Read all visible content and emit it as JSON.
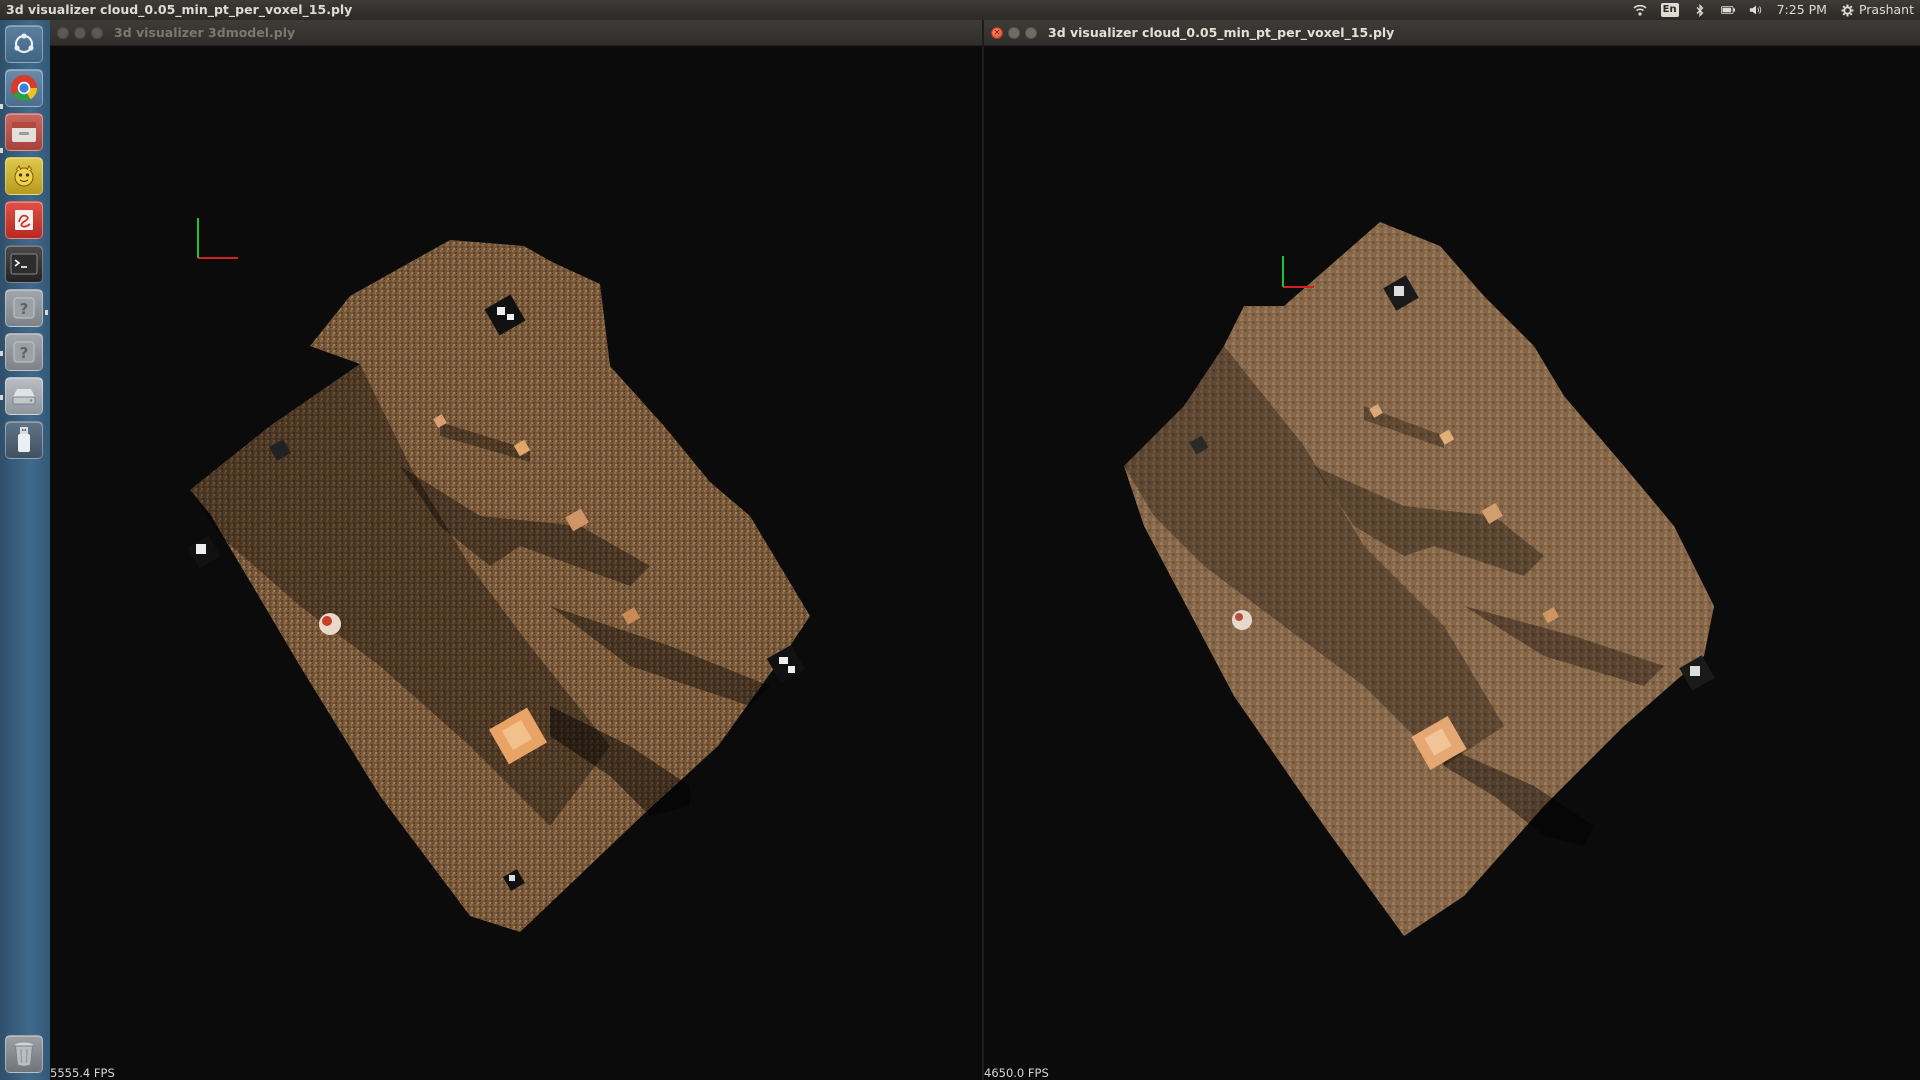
{
  "top_panel": {
    "title": "3d visualizer cloud_0.05_min_pt_per_voxel_15.ply",
    "indicators": {
      "wifi_icon": "wifi-icon",
      "keyboard_lang": "En",
      "bluetooth_icon": "bluetooth-icon",
      "battery_icon": "battery-icon",
      "volume_icon": "volume-icon",
      "clock": "7:25 PM",
      "session_icon": "gear-icon",
      "user": "Prashant"
    }
  },
  "launcher": {
    "items": [
      {
        "name": "dash-home-icon",
        "color": "#c9ced3"
      },
      {
        "name": "chrome-icon",
        "color": "#e8493a"
      },
      {
        "name": "files-icon",
        "color": "#c95b54"
      },
      {
        "name": "pyrenamer-icon",
        "color": "#d9c234"
      },
      {
        "name": "evince-icon",
        "color": "#d63a33"
      },
      {
        "name": "terminal-icon",
        "color": "#2d2d2d"
      },
      {
        "name": "unknown-app-icon",
        "color": "#8d9399"
      },
      {
        "name": "unknown-app-icon",
        "color": "#8d9399"
      },
      {
        "name": "drive-icon",
        "color": "#a5acb2"
      },
      {
        "name": "usb-drive-icon",
        "color": "#6a7a88"
      },
      {
        "name": "trash-icon",
        "color": "#8a8f93"
      }
    ]
  },
  "windows": {
    "left": {
      "title": "3d visualizer 3dmodel.ply",
      "fps": "5555.4 FPS",
      "state": "inactive"
    },
    "right": {
      "title": "3d visualizer cloud_0.05_min_pt_per_voxel_15.ply",
      "fps": "4650.0 FPS",
      "state": "active"
    }
  },
  "colors": {
    "panel_bg": "#2b2a27",
    "viewport_bg": "#0b0b0b",
    "ground_left": "#7a5a38",
    "ground_right": "#8a6a48",
    "axis_x": "#d21f1f",
    "axis_y": "#1fbf3a"
  }
}
